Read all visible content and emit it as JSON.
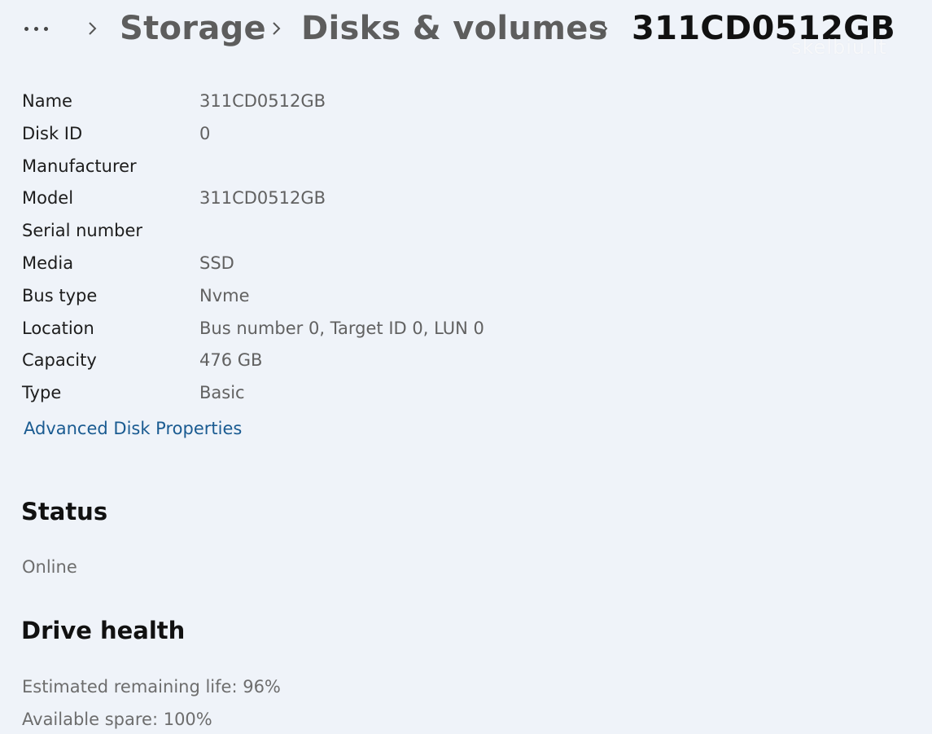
{
  "breadcrumb": {
    "more_icon": "more-horizontal-icon",
    "separator_icon": "chevron-right-icon",
    "items": [
      "Storage",
      "Disks & volumes",
      "311CD0512GB"
    ]
  },
  "watermark": "skelbiu.lt",
  "properties": [
    {
      "label": "Name",
      "value": "311CD0512GB"
    },
    {
      "label": "Disk ID",
      "value": "0"
    },
    {
      "label": "Manufacturer",
      "value": ""
    },
    {
      "label": "Model",
      "value": "311CD0512GB"
    },
    {
      "label": "Serial number",
      "value": ""
    },
    {
      "label": "Media",
      "value": "SSD"
    },
    {
      "label": "Bus type",
      "value": "Nvme"
    },
    {
      "label": "Location",
      "value": "Bus number 0, Target ID 0, LUN 0"
    },
    {
      "label": "Capacity",
      "value": "476 GB"
    },
    {
      "label": "Type",
      "value": "Basic"
    }
  ],
  "advanced_link": "Advanced Disk Properties",
  "status": {
    "heading": "Status",
    "value": "Online"
  },
  "drive_health": {
    "heading": "Drive health",
    "remaining_life": "Estimated remaining life: 96%",
    "available_spare": "Available spare: 100%"
  },
  "colors": {
    "background": "#eff3f9",
    "link": "#1a5b91",
    "label": "#1d1d1d",
    "value": "#616161"
  }
}
